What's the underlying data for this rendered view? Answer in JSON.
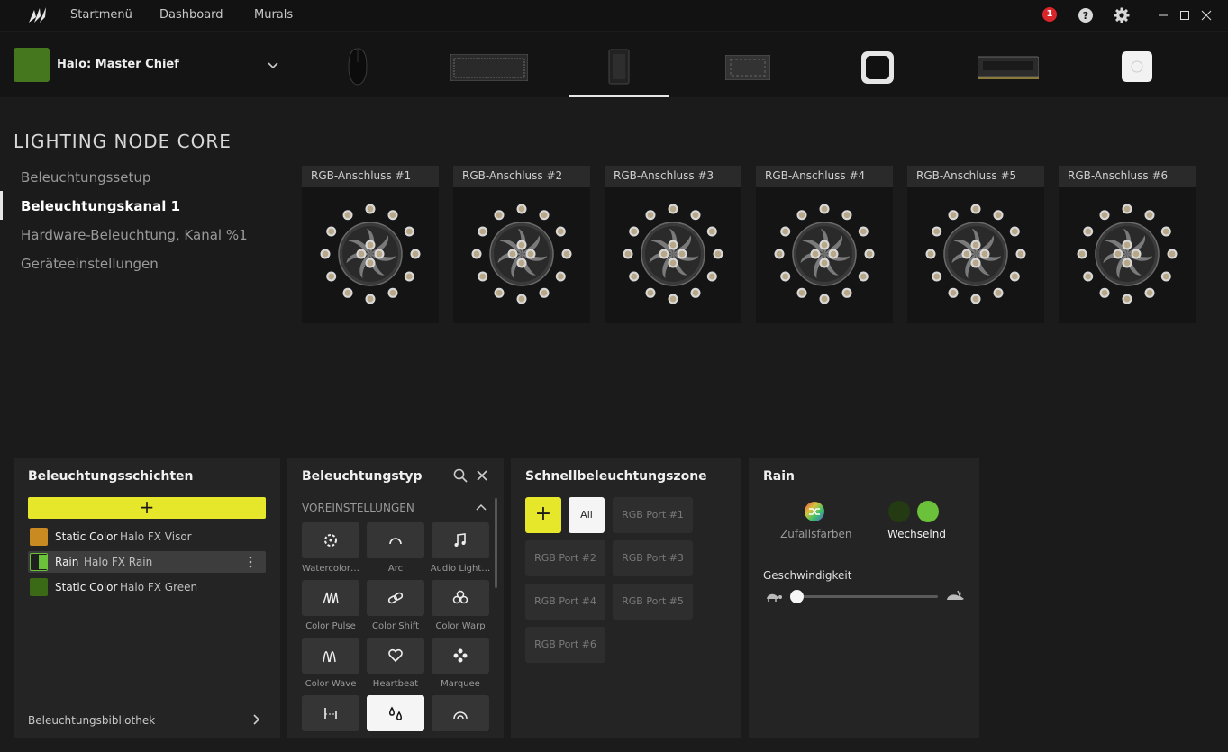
{
  "topbar": {
    "nav": [
      "Startmenü",
      "Dashboard",
      "Murals"
    ],
    "notification_count": "1"
  },
  "profile": {
    "name": "Halo: Master Chief",
    "color": "#45781e"
  },
  "page": {
    "title": "LIGHTING NODE CORE",
    "sidenav": [
      "Beleuchtungssetup",
      "Beleuchtungskanal 1",
      "Hardware-Beleuchtung, Kanal %1",
      "Geräteeinstellungen"
    ],
    "active_index": 1
  },
  "ports": [
    "RGB-Anschluss #1",
    "RGB-Anschluss #2",
    "RGB-Anschluss #3",
    "RGB-Anschluss #4",
    "RGB-Anschluss #5",
    "RGB-Anschluss #6"
  ],
  "layers_panel": {
    "title": "Beleuchtungsschichten",
    "layers": [
      {
        "name": "Static Color",
        "sub": "Halo FX Visor",
        "color": "#c98a22"
      },
      {
        "name": "Rain",
        "sub": "Halo FX Rain",
        "color": "#6cc13a"
      },
      {
        "name": "Static Color",
        "sub": "Halo FX Green",
        "color": "#3b6a17"
      }
    ],
    "library": "Beleuchtungsbibliothek"
  },
  "type_panel": {
    "title": "Beleuchtungstyp",
    "section": "VOREINSTELLUNGEN",
    "effects": [
      "Watercolor…",
      "Arc",
      "Audio Light…",
      "Color Pulse",
      "Color Shift",
      "Color Warp",
      "Color Wave",
      "Heartbeat",
      "Marquee"
    ]
  },
  "quick_panel": {
    "title": "Schnellbeleuchtungszone",
    "all": "All",
    "ports": [
      "RGB Port #1",
      "RGB Port #2",
      "RGB Port #3",
      "RGB Port #4",
      "RGB Port #5",
      "RGB Port #6"
    ]
  },
  "rain_panel": {
    "title": "Rain",
    "random": "Zufallsfarben",
    "alternating": "Wechselnd",
    "alt_colors": [
      "#233a12",
      "#6cc13a"
    ],
    "speed_label": "Geschwindigkeit",
    "speed_fraction": 0.03
  }
}
